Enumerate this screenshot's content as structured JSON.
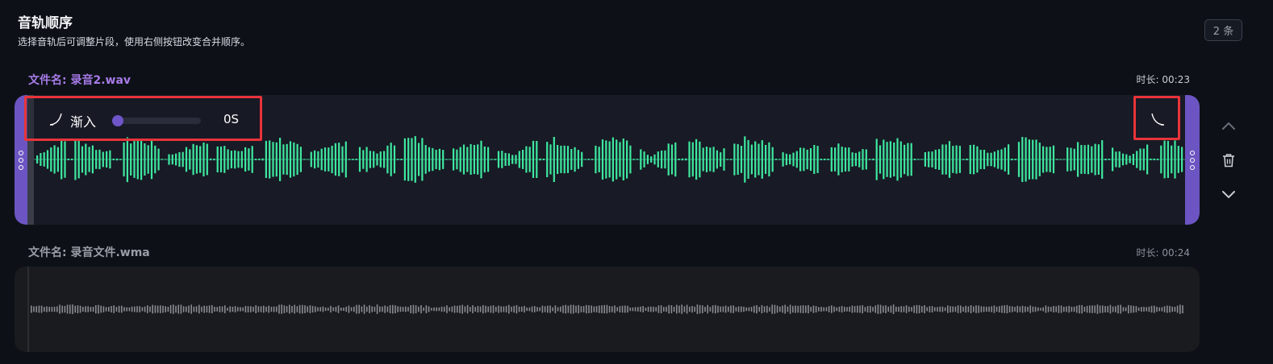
{
  "header": {
    "title": "音轨顺序",
    "subtitle": "选择音轨后可调整片段，使用右侧按钮改变合并顺序。",
    "count_badge": "2 条"
  },
  "tracks": [
    {
      "name": "文件名: 录音2.wav",
      "duration": "时长: 00:23",
      "selected": true,
      "wave_color": "#3ee8a0",
      "fade_in": {
        "label": "渐入",
        "value": "0S",
        "level": 0
      },
      "fade_out_icon": "fade-out-curve-icon"
    },
    {
      "name": "文件名: 录音文件.wma",
      "duration": "时长: 00:24",
      "selected": false,
      "wave_color": "#8a8c93"
    }
  ],
  "side_controls": [
    "chevron-up-icon",
    "trash-icon",
    "chevron-down-icon"
  ],
  "colors": {
    "accent": "#6c55c2",
    "highlight": "#e8343a",
    "track_name_active": "#a77be8"
  }
}
